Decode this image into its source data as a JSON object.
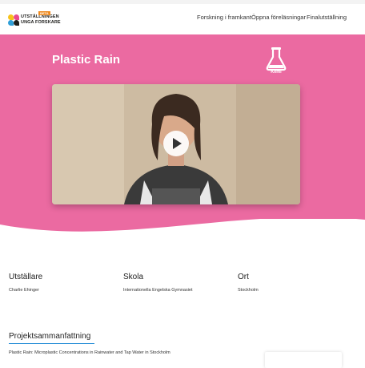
{
  "header": {
    "logo_line1": "UTSTÄLLNINGEN",
    "logo_line2": "UNGA FORSKARE",
    "logo_badge": "BETA",
    "nav": [
      "Forskning i framkant",
      "Öppna föreläsningar",
      "Finalutställning"
    ]
  },
  "hero": {
    "title": "Plastic Rain",
    "category": "Kemi",
    "category_icon": "flask-icon",
    "background": "#eb6aa1"
  },
  "video": {
    "play_icon": "play-icon"
  },
  "info": {
    "exhibitor_label": "Utställare",
    "exhibitor_value": "Charlie Ehinger",
    "school_label": "Skola",
    "school_value": "Internationella Engelska Gymnasiet",
    "city_label": "Ort",
    "city_value": "Stockholm"
  },
  "summary": {
    "heading": "Projektsammanfattning",
    "text": "Plastic Rain: Microplastic Concentrations in Rainwater and Tap Water in Stockholm"
  },
  "colors": {
    "accent": "#eb6aa1",
    "link_underline": "#2a8fd8"
  }
}
